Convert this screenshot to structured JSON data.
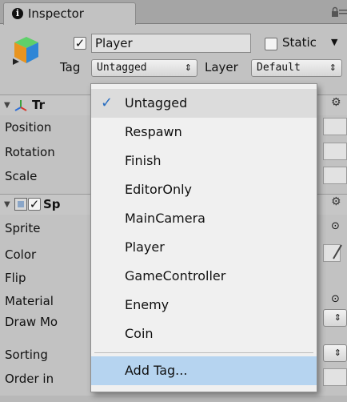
{
  "window": {
    "tab_title": "Inspector",
    "tab_icon": "i"
  },
  "object": {
    "active": true,
    "name": "Player",
    "static_label": "Static",
    "static_checked": false
  },
  "tag_row": {
    "tag_label": "Tag",
    "tag_value": "Untagged",
    "layer_label": "Layer",
    "layer_value": "Default"
  },
  "transform": {
    "title": "Tr",
    "rows": [
      "Position",
      "Rotation",
      "Scale"
    ]
  },
  "sprite_renderer": {
    "title": "Sp",
    "enabled": true,
    "rows": [
      "Sprite",
      "Color",
      "Flip",
      "Material",
      "Draw Mo",
      "Sorting",
      "Order in"
    ]
  },
  "tag_menu": {
    "items": [
      "Untagged",
      "Respawn",
      "Finish",
      "EditorOnly",
      "MainCamera",
      "Player",
      "GameController",
      "Enemy",
      "Coin"
    ],
    "checked_index": 0,
    "add_tag": "Add Tag...",
    "check_glyph": "✓"
  },
  "colors": {
    "highlight": "#b6d4f0",
    "check": "#2b6fc1"
  }
}
